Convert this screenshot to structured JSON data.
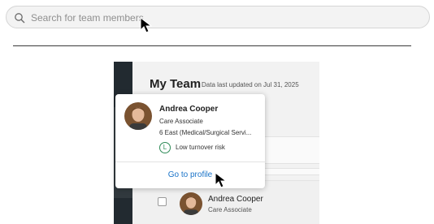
{
  "search": {
    "placeholder": "Search for team members"
  },
  "team": {
    "title": "My Team",
    "last_updated": "Data last updated on Jul 31, 2025"
  },
  "popover": {
    "name": "Andrea Cooper",
    "role": "Care Associate",
    "unit": "6 East (Medical/Surgical Servi...",
    "risk_badge": "L",
    "risk_label": "Low turnover risk",
    "profile_link": "Go to profile"
  },
  "row": {
    "name": "Andrea Cooper",
    "role": "Care Associate"
  },
  "colors": {
    "link": "#1a73c8",
    "risk_green": "#2e8b57",
    "side_rail": "#222a30"
  },
  "icons": [
    "search-icon",
    "mouse-cursor-icon",
    "avatar"
  ]
}
